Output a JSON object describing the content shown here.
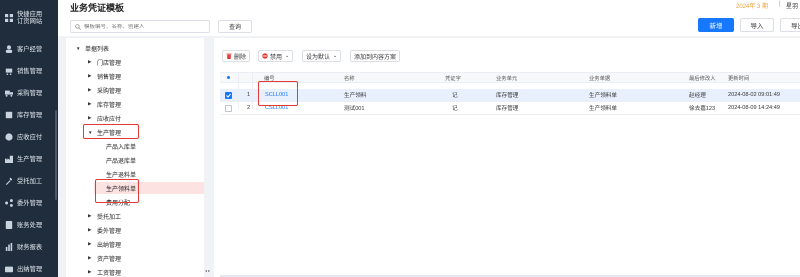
{
  "nav": {
    "items": [
      {
        "label": "快捷应用\n订货网站",
        "icon": "grid-icon"
      },
      {
        "label": "客户经营",
        "icon": "users-icon"
      },
      {
        "label": "销售管理",
        "icon": "cart-icon"
      },
      {
        "label": "采购管理",
        "icon": "truck-icon"
      },
      {
        "label": "库存管理",
        "icon": "box-icon"
      },
      {
        "label": "应收应付",
        "icon": "money-icon"
      },
      {
        "label": "生产管理",
        "icon": "factory-icon"
      },
      {
        "label": "受托加工",
        "icon": "tool-icon"
      },
      {
        "label": "委外管理",
        "icon": "share-icon"
      },
      {
        "label": "账务处理",
        "icon": "ledger-icon"
      },
      {
        "label": "财务报表",
        "icon": "report-icon"
      },
      {
        "label": "出纳管理",
        "icon": "wallet-icon"
      }
    ]
  },
  "header": {
    "title": "业务凭证模板",
    "search_placeholder": "模板编号、名称、创建人",
    "query_label": "查询",
    "year_label": "2024年 3 期",
    "sep": "|",
    "right_text": "星羽",
    "new_label": "新增",
    "import_label": "导入",
    "export_label": "导出"
  },
  "tree": {
    "nodes": [
      {
        "label": "单据列表",
        "level": 0,
        "expanded": true
      },
      {
        "label": "门店管理",
        "level": 1,
        "expanded": false
      },
      {
        "label": "销售管理",
        "level": 1,
        "expanded": false
      },
      {
        "label": "采购管理",
        "level": 1,
        "expanded": false
      },
      {
        "label": "库存管理",
        "level": 1,
        "expanded": false
      },
      {
        "label": "应收应付",
        "level": 1,
        "expanded": false
      },
      {
        "label": "生产管理",
        "level": 1,
        "expanded": true
      },
      {
        "label": "产品入库单",
        "level": 2
      },
      {
        "label": "产品退库单",
        "level": 2
      },
      {
        "label": "生产退料单",
        "level": 2
      },
      {
        "label": "生产领料单",
        "level": 2,
        "selected": true
      },
      {
        "label": "费用分配",
        "level": 2
      },
      {
        "label": "受托加工",
        "level": 1,
        "expanded": false
      },
      {
        "label": "委外管理",
        "level": 1,
        "expanded": false
      },
      {
        "label": "出纳管理",
        "level": 1,
        "expanded": false
      },
      {
        "label": "资产管理",
        "level": 1,
        "expanded": false
      },
      {
        "label": "工资管理",
        "level": 1,
        "expanded": false
      }
    ]
  },
  "splitter": {
    "label": "◂ ▸"
  },
  "toolbar": {
    "delete_label": "删除",
    "disable_label": "禁用",
    "set_default_label": "设为默认",
    "add_to_content_label": "添加到内容方案"
  },
  "grid": {
    "headers": {
      "code": "编号",
      "name": "名称",
      "voucher_word": "凭证字",
      "biz_unit": "业务单元",
      "biz_doc": "业务单据",
      "modifier": "最后修改人",
      "updated": "更新时间"
    },
    "rows": [
      {
        "idx": "1",
        "code": "SCLL001",
        "name": "生产领料",
        "voucher_word": "记",
        "biz_unit": "库存管理",
        "biz_doc": "生产领料单",
        "modifier": "赵经理",
        "updated": "2024-08-02 09:01:49",
        "checked": true
      },
      {
        "idx": "2",
        "code": "CSLL001",
        "name": "测试001",
        "voucher_word": "记",
        "biz_unit": "库存管理",
        "biz_doc": "生产领料单",
        "modifier": "徐去嘉123",
        "updated": "2024-08-09 14:24:49",
        "checked": false
      }
    ]
  },
  "colors": {
    "accent": "#1677ff",
    "highlight": "#e53935",
    "nav_bg": "#1f2d3d"
  }
}
